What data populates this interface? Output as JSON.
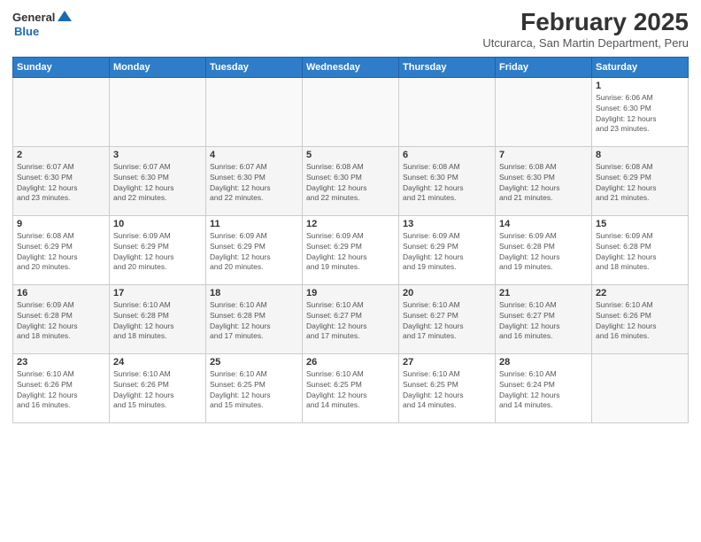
{
  "header": {
    "logo": {
      "general": "General",
      "blue": "Blue"
    },
    "title": "February 2025",
    "subtitle": "Utcurarca, San Martin Department, Peru"
  },
  "calendar": {
    "weekdays": [
      "Sunday",
      "Monday",
      "Tuesday",
      "Wednesday",
      "Thursday",
      "Friday",
      "Saturday"
    ],
    "weeks": [
      [
        {
          "day": "",
          "info": ""
        },
        {
          "day": "",
          "info": ""
        },
        {
          "day": "",
          "info": ""
        },
        {
          "day": "",
          "info": ""
        },
        {
          "day": "",
          "info": ""
        },
        {
          "day": "",
          "info": ""
        },
        {
          "day": "1",
          "info": "Sunrise: 6:06 AM\nSunset: 6:30 PM\nDaylight: 12 hours\nand 23 minutes."
        }
      ],
      [
        {
          "day": "2",
          "info": "Sunrise: 6:07 AM\nSunset: 6:30 PM\nDaylight: 12 hours\nand 23 minutes."
        },
        {
          "day": "3",
          "info": "Sunrise: 6:07 AM\nSunset: 6:30 PM\nDaylight: 12 hours\nand 22 minutes."
        },
        {
          "day": "4",
          "info": "Sunrise: 6:07 AM\nSunset: 6:30 PM\nDaylight: 12 hours\nand 22 minutes."
        },
        {
          "day": "5",
          "info": "Sunrise: 6:08 AM\nSunset: 6:30 PM\nDaylight: 12 hours\nand 22 minutes."
        },
        {
          "day": "6",
          "info": "Sunrise: 6:08 AM\nSunset: 6:30 PM\nDaylight: 12 hours\nand 21 minutes."
        },
        {
          "day": "7",
          "info": "Sunrise: 6:08 AM\nSunset: 6:30 PM\nDaylight: 12 hours\nand 21 minutes."
        },
        {
          "day": "8",
          "info": "Sunrise: 6:08 AM\nSunset: 6:29 PM\nDaylight: 12 hours\nand 21 minutes."
        }
      ],
      [
        {
          "day": "9",
          "info": "Sunrise: 6:08 AM\nSunset: 6:29 PM\nDaylight: 12 hours\nand 20 minutes."
        },
        {
          "day": "10",
          "info": "Sunrise: 6:09 AM\nSunset: 6:29 PM\nDaylight: 12 hours\nand 20 minutes."
        },
        {
          "day": "11",
          "info": "Sunrise: 6:09 AM\nSunset: 6:29 PM\nDaylight: 12 hours\nand 20 minutes."
        },
        {
          "day": "12",
          "info": "Sunrise: 6:09 AM\nSunset: 6:29 PM\nDaylight: 12 hours\nand 19 minutes."
        },
        {
          "day": "13",
          "info": "Sunrise: 6:09 AM\nSunset: 6:29 PM\nDaylight: 12 hours\nand 19 minutes."
        },
        {
          "day": "14",
          "info": "Sunrise: 6:09 AM\nSunset: 6:28 PM\nDaylight: 12 hours\nand 19 minutes."
        },
        {
          "day": "15",
          "info": "Sunrise: 6:09 AM\nSunset: 6:28 PM\nDaylight: 12 hours\nand 18 minutes."
        }
      ],
      [
        {
          "day": "16",
          "info": "Sunrise: 6:09 AM\nSunset: 6:28 PM\nDaylight: 12 hours\nand 18 minutes."
        },
        {
          "day": "17",
          "info": "Sunrise: 6:10 AM\nSunset: 6:28 PM\nDaylight: 12 hours\nand 18 minutes."
        },
        {
          "day": "18",
          "info": "Sunrise: 6:10 AM\nSunset: 6:28 PM\nDaylight: 12 hours\nand 17 minutes."
        },
        {
          "day": "19",
          "info": "Sunrise: 6:10 AM\nSunset: 6:27 PM\nDaylight: 12 hours\nand 17 minutes."
        },
        {
          "day": "20",
          "info": "Sunrise: 6:10 AM\nSunset: 6:27 PM\nDaylight: 12 hours\nand 17 minutes."
        },
        {
          "day": "21",
          "info": "Sunrise: 6:10 AM\nSunset: 6:27 PM\nDaylight: 12 hours\nand 16 minutes."
        },
        {
          "day": "22",
          "info": "Sunrise: 6:10 AM\nSunset: 6:26 PM\nDaylight: 12 hours\nand 16 minutes."
        }
      ],
      [
        {
          "day": "23",
          "info": "Sunrise: 6:10 AM\nSunset: 6:26 PM\nDaylight: 12 hours\nand 16 minutes."
        },
        {
          "day": "24",
          "info": "Sunrise: 6:10 AM\nSunset: 6:26 PM\nDaylight: 12 hours\nand 15 minutes."
        },
        {
          "day": "25",
          "info": "Sunrise: 6:10 AM\nSunset: 6:25 PM\nDaylight: 12 hours\nand 15 minutes."
        },
        {
          "day": "26",
          "info": "Sunrise: 6:10 AM\nSunset: 6:25 PM\nDaylight: 12 hours\nand 14 minutes."
        },
        {
          "day": "27",
          "info": "Sunrise: 6:10 AM\nSunset: 6:25 PM\nDaylight: 12 hours\nand 14 minutes."
        },
        {
          "day": "28",
          "info": "Sunrise: 6:10 AM\nSunset: 6:24 PM\nDaylight: 12 hours\nand 14 minutes."
        },
        {
          "day": "",
          "info": ""
        }
      ]
    ]
  }
}
